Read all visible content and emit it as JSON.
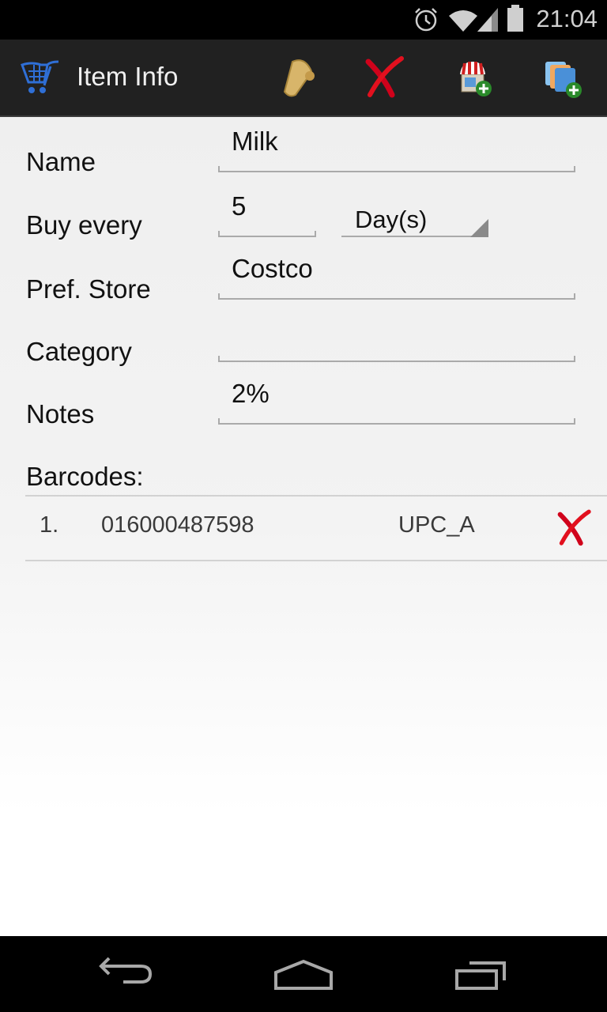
{
  "status_bar": {
    "time": "21:04",
    "icons": [
      "alarm-icon",
      "wifi-icon",
      "signal-icon",
      "battery-icon"
    ]
  },
  "action_bar": {
    "title": "Item Info",
    "app_icon": "shopping-cart-icon",
    "actions": [
      {
        "name": "scroll-notes-icon",
        "label": "Notes"
      },
      {
        "name": "delete-icon",
        "label": "Delete"
      },
      {
        "name": "add-store-icon",
        "label": "Add Store"
      },
      {
        "name": "add-category-icon",
        "label": "Add Category"
      }
    ]
  },
  "form": {
    "name": {
      "label": "Name",
      "value": "Milk"
    },
    "buy_every": {
      "label": "Buy every",
      "value": "5",
      "unit": "Day(s)"
    },
    "pref_store": {
      "label": "Pref. Store",
      "value": "Costco"
    },
    "category": {
      "label": "Category",
      "value": ""
    },
    "notes": {
      "label": "Notes",
      "value": "2%"
    }
  },
  "barcodes": {
    "label": "Barcodes:",
    "items": [
      {
        "index": "1.",
        "code": "016000487598",
        "type": "UPC_A"
      }
    ]
  },
  "nav_bar": {
    "buttons": [
      "back-icon",
      "home-icon",
      "recents-icon"
    ]
  },
  "colors": {
    "action_bar_bg": "#212121",
    "delete_red": "#d0021b",
    "cart_blue": "#2f6fd6"
  }
}
